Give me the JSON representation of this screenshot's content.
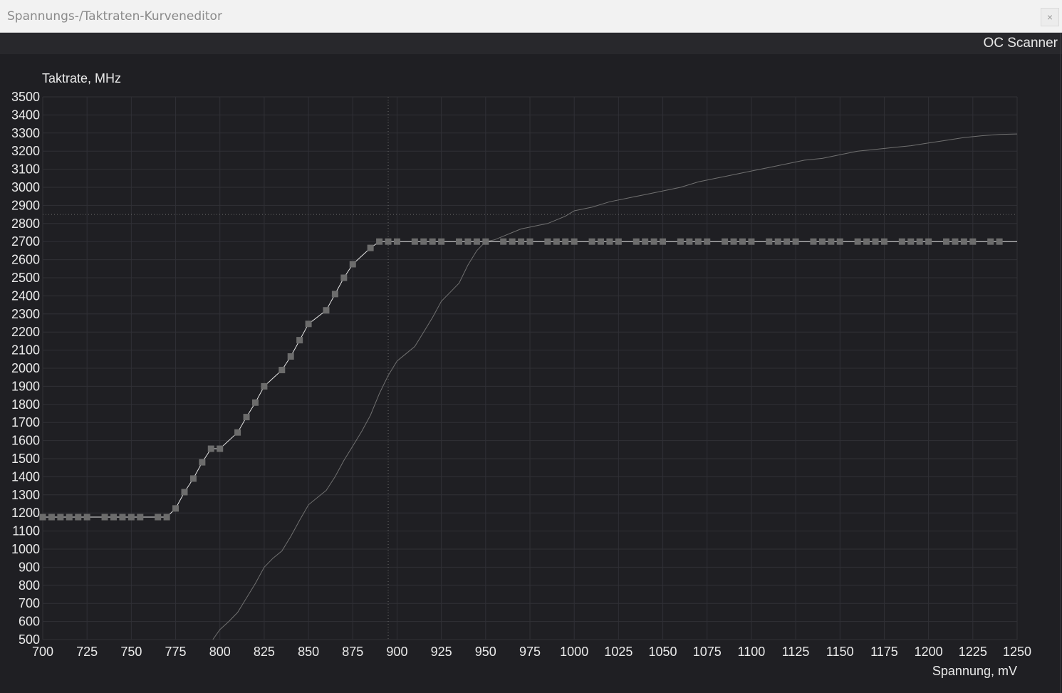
{
  "window": {
    "title": "Spannungs-/Taktraten-Kurveneditor",
    "close_label": "×"
  },
  "toolbar": {
    "oc_scanner_label": "OC Scanner"
  },
  "colors": {
    "background": "#1f1f23",
    "plot_background": "#1f1f23",
    "grid": "#303036",
    "curve": "#e6e6e6",
    "point": "#6c6c6c",
    "reference_curve": "#707070",
    "titlebar": "#f2f2f2"
  },
  "chart_data": {
    "type": "line",
    "ylabel": "Taktrate, MHz",
    "xlabel": "Spannung, mV",
    "xlim": [
      700,
      1250
    ],
    "ylim": [
      500,
      3500
    ],
    "x_ticks": [
      700,
      725,
      750,
      775,
      800,
      825,
      850,
      875,
      900,
      925,
      950,
      975,
      1000,
      1025,
      1050,
      1075,
      1100,
      1125,
      1150,
      1175,
      1200,
      1225,
      1250
    ],
    "y_ticks": [
      500,
      600,
      700,
      800,
      900,
      1000,
      1100,
      1200,
      1300,
      1400,
      1500,
      1600,
      1700,
      1800,
      1900,
      2000,
      2100,
      2200,
      2300,
      2400,
      2500,
      2600,
      2700,
      2800,
      2900,
      3000,
      3100,
      3200,
      3300,
      3400,
      3500
    ],
    "grid": true,
    "crosshair": {
      "x": 895,
      "y": 2850
    },
    "series": [
      {
        "role": "editable-curve",
        "x": [
          700,
          705,
          710,
          715,
          720,
          725,
          735,
          740,
          745,
          750,
          755,
          765,
          770,
          775,
          780,
          785,
          790,
          795,
          800,
          810,
          815,
          820,
          825,
          835,
          840,
          845,
          850,
          860,
          865,
          870,
          875,
          885,
          890,
          895,
          900,
          910,
          915,
          920,
          925,
          935,
          940,
          945,
          950,
          960,
          965,
          970,
          975,
          985,
          990,
          995,
          1000,
          1010,
          1015,
          1020,
          1025,
          1035,
          1040,
          1045,
          1050,
          1060,
          1065,
          1070,
          1075,
          1085,
          1090,
          1095,
          1100,
          1110,
          1115,
          1120,
          1125,
          1135,
          1140,
          1145,
          1150,
          1160,
          1165,
          1170,
          1175,
          1185,
          1190,
          1195,
          1200,
          1210,
          1215,
          1220,
          1225,
          1235,
          1240
        ],
        "y": [
          1177,
          1177,
          1177,
          1177,
          1177,
          1177,
          1177,
          1177,
          1177,
          1177,
          1177,
          1177,
          1177,
          1225,
          1315,
          1390,
          1480,
          1555,
          1555,
          1645,
          1730,
          1810,
          1900,
          1990,
          2065,
          2155,
          2245,
          2320,
          2410,
          2500,
          2575,
          2665,
          2700,
          2700,
          2700,
          2700,
          2700,
          2700,
          2700,
          2700,
          2700,
          2700,
          2700,
          2700,
          2700,
          2700,
          2700,
          2700,
          2700,
          2700,
          2700,
          2700,
          2700,
          2700,
          2700,
          2700,
          2700,
          2700,
          2700,
          2700,
          2700,
          2700,
          2700,
          2700,
          2700,
          2700,
          2700,
          2700,
          2700,
          2700,
          2700,
          2700,
          2700,
          2700,
          2700,
          2700,
          2700,
          2700,
          2700,
          2700,
          2700,
          2700,
          2700,
          2700,
          2700,
          2700,
          2700,
          2700,
          2700
        ]
      },
      {
        "role": "reference-curve",
        "x": [
          796,
          800,
          805,
          810,
          815,
          820,
          825,
          830,
          835,
          840,
          845,
          850,
          855,
          860,
          865,
          870,
          875,
          880,
          885,
          890,
          895,
          900,
          905,
          910,
          915,
          920,
          925,
          930,
          935,
          940,
          945,
          950,
          955,
          960,
          965,
          970,
          975,
          980,
          985,
          990,
          995,
          1000,
          1010,
          1020,
          1030,
          1040,
          1050,
          1060,
          1070,
          1080,
          1090,
          1100,
          1110,
          1120,
          1130,
          1140,
          1150,
          1160,
          1170,
          1180,
          1190,
          1200,
          1210,
          1220,
          1230,
          1240,
          1250
        ],
        "y": [
          500,
          555,
          600,
          650,
          730,
          810,
          900,
          950,
          990,
          1070,
          1160,
          1245,
          1285,
          1325,
          1400,
          1490,
          1570,
          1650,
          1740,
          1860,
          1960,
          2040,
          2080,
          2120,
          2200,
          2280,
          2370,
          2420,
          2470,
          2570,
          2650,
          2700,
          2710,
          2730,
          2750,
          2770,
          2780,
          2790,
          2800,
          2820,
          2840,
          2870,
          2890,
          2920,
          2940,
          2960,
          2980,
          3000,
          3030,
          3050,
          3070,
          3090,
          3110,
          3130,
          3150,
          3160,
          3180,
          3200,
          3210,
          3220,
          3230,
          3245,
          3260,
          3275,
          3285,
          3292,
          3295
        ]
      }
    ]
  }
}
